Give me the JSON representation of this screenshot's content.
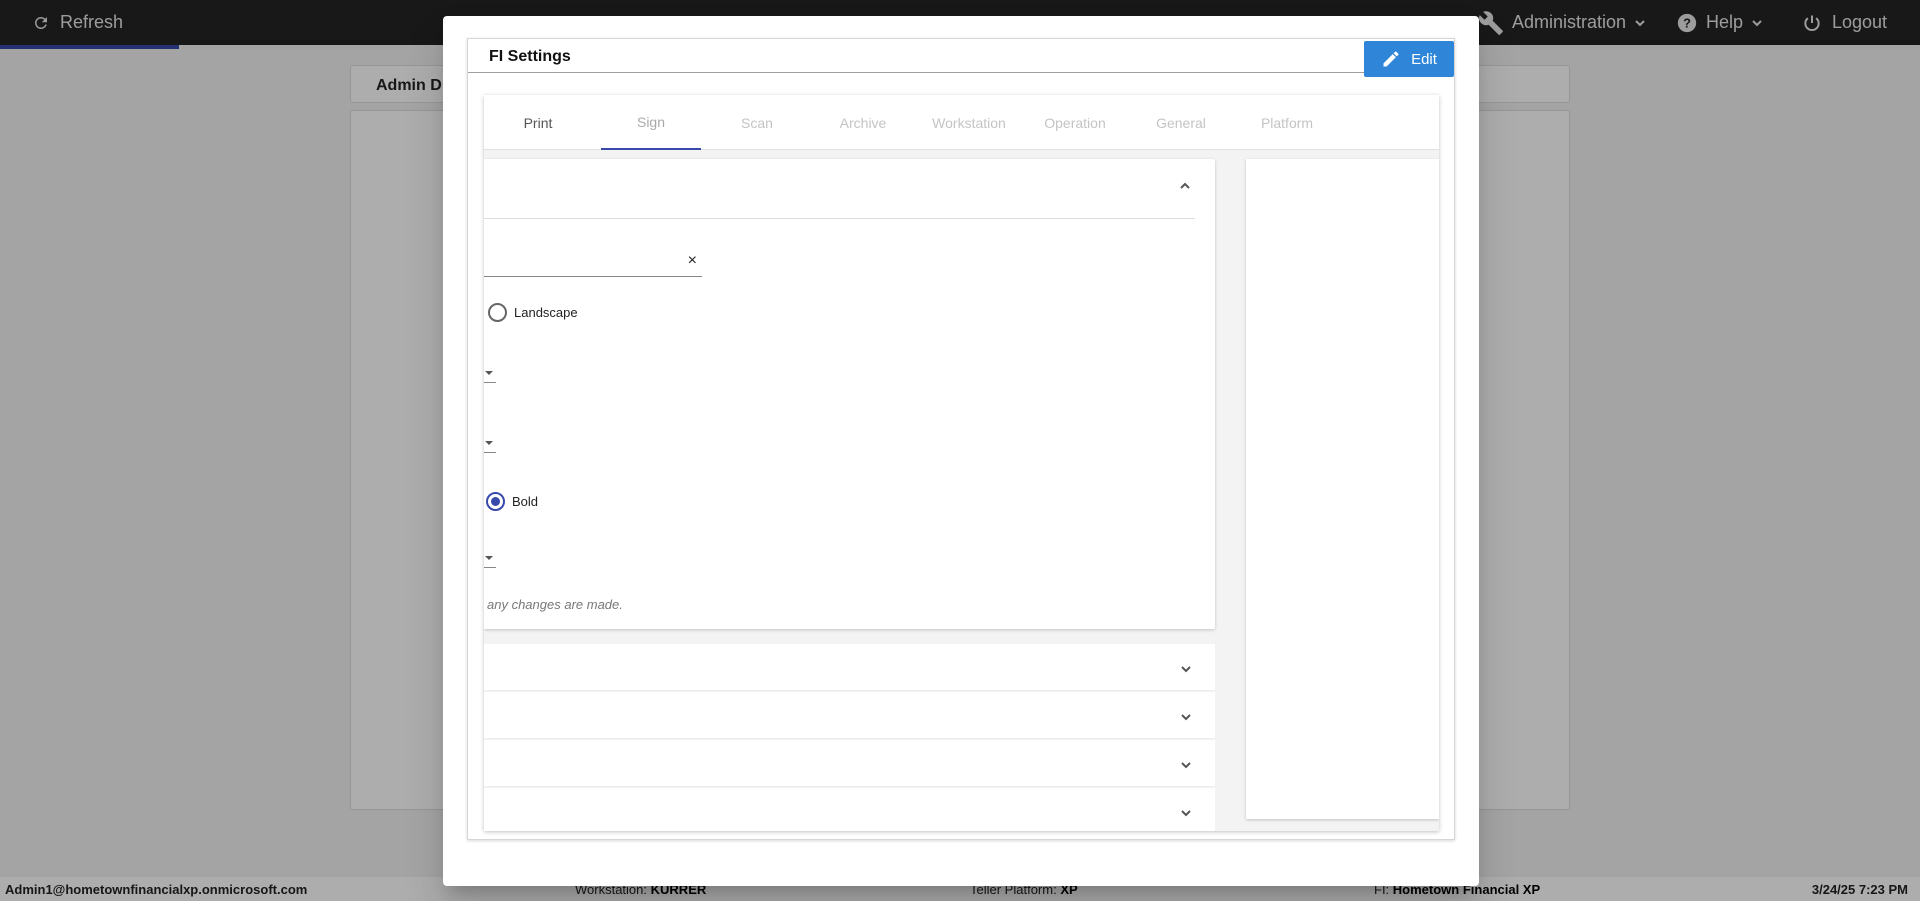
{
  "topbar": {
    "refresh_label": "Refresh",
    "administration_label": "Administration",
    "help_label": "Help",
    "logout_label": "Logout"
  },
  "background": {
    "card_title": "Admin D"
  },
  "footer": {
    "user": "Admin1@hometownfinancialxp.onmicrosoft.com",
    "workstation_label": "Workstation:",
    "workstation_value": "KURRER",
    "teller_platform_label": "Teller Platform:",
    "teller_platform_value": "XP",
    "fi_label": "FI:",
    "fi_value": "Hometown Financial XP",
    "datetime": "3/24/25 7:23 PM"
  },
  "dialog": {
    "title": "FI Settings",
    "edit_label": "Edit",
    "tabs": [
      {
        "label": "Print",
        "state": "enabled"
      },
      {
        "label": "Sign",
        "state": "active"
      },
      {
        "label": "Scan",
        "state": "disabled"
      },
      {
        "label": "Archive",
        "state": "disabled"
      },
      {
        "label": "Workstation",
        "state": "disabled"
      },
      {
        "label": "Operation",
        "state": "disabled"
      },
      {
        "label": "General",
        "state": "disabled"
      },
      {
        "label": "Platform",
        "state": "disabled"
      }
    ],
    "section": {
      "text_value": "",
      "clear_symbol": "×",
      "orientation_option": "Landscape",
      "orientation_checked": false,
      "font_style_option": "Bold",
      "font_style_checked": true,
      "hint": "any changes are made."
    }
  },
  "colors": {
    "accent": "#3949ab",
    "edit_button": "#2f86d9",
    "topbar": "#242424"
  }
}
